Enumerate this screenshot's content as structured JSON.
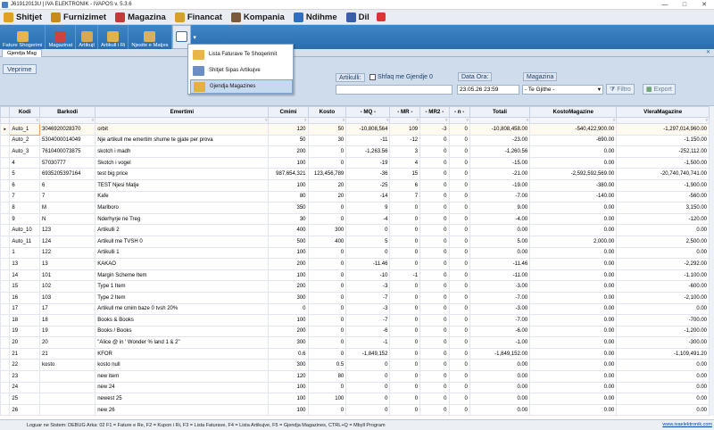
{
  "window": {
    "title": "J61912013U | IVA ELEKTRONIK - IVAPOS v. 5.3.6",
    "controls": [
      "—",
      "□",
      "✕"
    ]
  },
  "menu": [
    {
      "label": "Shitjet",
      "color": "#e0a020"
    },
    {
      "label": "Furnizimet",
      "color": "#c88a1c"
    },
    {
      "label": "Magazina",
      "color": "#c23b3b"
    },
    {
      "label": "Financat",
      "color": "#d6a12b"
    },
    {
      "label": "Kompania",
      "color": "#7a5a3a"
    },
    {
      "label": "Ndihme",
      "color": "#2f6fbf"
    },
    {
      "label": "Dil",
      "color": "#3a5ea8"
    }
  ],
  "toolbar": [
    {
      "label": "Fature Shogerimi",
      "color": "#e9b54a"
    },
    {
      "label": "Magazinat",
      "color": "#c9463d"
    },
    {
      "label": "Artikujt",
      "color": "#d8a84a"
    },
    {
      "label": "Artikull i Ri",
      "color": "#e2b349"
    },
    {
      "label": "Njesite e Matjes",
      "color": "#d9b15c"
    }
  ],
  "tab": {
    "label": "Gjendja Mag",
    "close": "✕"
  },
  "dropdown": [
    {
      "label": "Lista Faturave Te Shoqerimit"
    },
    {
      "label": "Shitjet Sipas Artikujve"
    },
    {
      "label": "Gjendja Magazines"
    }
  ],
  "filters": {
    "veprime": "Veprime",
    "artikulli_label": "Artikulli:",
    "shfaq_label": "Shfaq me Gjendje 0",
    "data_ora_label": "Data Ora:",
    "data_ora_value": "23.05.26 23:59",
    "magazina_label": "Magazina",
    "magazina_value": "- Te Gjithe -",
    "filtro": "Filtro",
    "export": "Export"
  },
  "columns": [
    "Kodi",
    "Barkodi",
    "Emertimi",
    "Cmimi",
    "Kosto",
    "- MQ -",
    "- MR -",
    "- MR2 -",
    "- n -",
    "Totali",
    "KostoMagazine",
    "VleraMagazine"
  ],
  "rows": [
    [
      "Auto_1",
      "3046920028370",
      "orbit",
      "120",
      "50",
      "-10,808,564",
      "109",
      "-3",
      "0",
      "-10,808,458.00",
      "-540,422,900.00",
      "-1,297,014,960.00"
    ],
    [
      "Auto_2",
      "5304000014049",
      "Nje artikull me emertim shume te gjate per prova",
      "50",
      "30",
      "-11",
      "-12",
      "0",
      "0",
      "-23.00",
      "-690.00",
      "-1,150.00"
    ],
    [
      "Auto_3",
      "7610400073875",
      "skotch i madh",
      "200",
      "0",
      "-1,263.56",
      "3",
      "0",
      "0",
      "-1,260.56",
      "0.00",
      "-252,112.00"
    ],
    [
      "4",
      "57030777",
      "Skotch i vogel",
      "100",
      "0",
      "-19",
      "4",
      "0",
      "0",
      "-15.00",
      "0.00",
      "-1,500.00"
    ],
    [
      "5",
      "6935205397164",
      "test big price",
      "987,654,321",
      "123,456,789",
      "-36",
      "15",
      "0",
      "0",
      "-21.00",
      "-2,592,592,569.00",
      "-20,740,740,741.00"
    ],
    [
      "6",
      "6",
      "TEST Njesi Matje",
      "100",
      "20",
      "-25",
      "6",
      "0",
      "0",
      "-19.00",
      "-380.00",
      "-1,900.00"
    ],
    [
      "7",
      "7",
      "Kafe",
      "80",
      "20",
      "-14",
      "7",
      "0",
      "0",
      "-7.00",
      "-140.00",
      "-560.00"
    ],
    [
      "8",
      "M",
      "Marlboro",
      "350",
      "0",
      "9",
      "0",
      "0",
      "0",
      "9.00",
      "0.00",
      "3,150.00"
    ],
    [
      "9",
      "N",
      "Nderhyrje ne Treg",
      "30",
      "0",
      "-4",
      "0",
      "0",
      "0",
      "-4.00",
      "0.00",
      "-120.00"
    ],
    [
      "Auto_10",
      "123",
      "Artikulli 2",
      "400",
      "300",
      "0",
      "0",
      "0",
      "0",
      "0.00",
      "0.00",
      "0.00"
    ],
    [
      "Auto_11",
      "124",
      "Artikull me TVSH 0",
      "500",
      "400",
      "5",
      "0",
      "0",
      "0",
      "5.00",
      "2,000.00",
      "2,500.00"
    ],
    [
      "1",
      "122",
      "Artikulli 1",
      "100",
      "0",
      "0",
      "0",
      "0",
      "0",
      "0.00",
      "0.00",
      "0.00"
    ],
    [
      "13",
      "13",
      "KAKAO",
      "200",
      "0",
      "-11.46",
      "0",
      "0",
      "0",
      "-11.46",
      "0.00",
      "-2,292.00"
    ],
    [
      "14",
      "101",
      "Margin Scheme Item",
      "100",
      "0",
      "-10",
      "-1",
      "0",
      "0",
      "-11.00",
      "0.00",
      "-1,100.00"
    ],
    [
      "15",
      "102",
      "Type 1 Item",
      "200",
      "0",
      "-3",
      "0",
      "0",
      "0",
      "-3.00",
      "0.00",
      "-600.00"
    ],
    [
      "16",
      "103",
      "Type 2 Item",
      "300",
      "0",
      "-7",
      "0",
      "0",
      "0",
      "-7.00",
      "0.00",
      "-2,100.00"
    ],
    [
      "17",
      "17",
      "Artikull me cmim baze 0 tvsh 20%",
      "0",
      "0",
      "-3",
      "0",
      "0",
      "0",
      "-3.00",
      "0.00",
      "0.00"
    ],
    [
      "18",
      "18",
      "Books & Books",
      "100",
      "0",
      "-7",
      "0",
      "0",
      "0",
      "-7.00",
      "0.00",
      "-700.00"
    ],
    [
      "19",
      "19",
      "Books / Books",
      "200",
      "0",
      "-6",
      "0",
      "0",
      "0",
      "-6.00",
      "0.00",
      "-1,200.00"
    ],
    [
      "20",
      "20",
      "\"Alice @ in ' Wonder % land 1 & 2\"",
      "300",
      "0",
      "-1",
      "0",
      "0",
      "0",
      "-1.00",
      "0.00",
      "-300.00"
    ],
    [
      "21",
      "21",
      "KFOR",
      "0.6",
      "0",
      "-1,849,152",
      "0",
      "0",
      "0",
      "-1,849,152.00",
      "0.00",
      "-1,109,491.20"
    ],
    [
      "22",
      "kosto",
      "kosto null",
      "300",
      "0.5",
      "0",
      "0",
      "0",
      "0",
      "0.00",
      "0.00",
      "0.00"
    ],
    [
      "23",
      "",
      "new item",
      "120",
      "80",
      "0",
      "0",
      "0",
      "0",
      "0.00",
      "0.00",
      "0.00"
    ],
    [
      "24",
      "",
      "new 24",
      "100",
      "0",
      "0",
      "0",
      "0",
      "0",
      "0.00",
      "0.00",
      "0.00"
    ],
    [
      "25",
      "",
      "newest 25",
      "100",
      "100",
      "0",
      "0",
      "0",
      "0",
      "0.00",
      "0.00",
      "0.00"
    ],
    [
      "26",
      "",
      "new 26",
      "100",
      "0",
      "0",
      "0",
      "0",
      "0",
      "0.00",
      "0.00",
      "0.00"
    ]
  ],
  "status": {
    "text": "Loguar ne Sistem: DEBUG  Arka: 02  F1 = Fature e Re, F2 = Kupon i Ri, F3 = Lista Faturave, F4 = Lista Artikujve, F5 = Gjendja Magazines, CTRL+Q = Mbyll Program",
    "link": "www.ivaelektronik.com"
  }
}
